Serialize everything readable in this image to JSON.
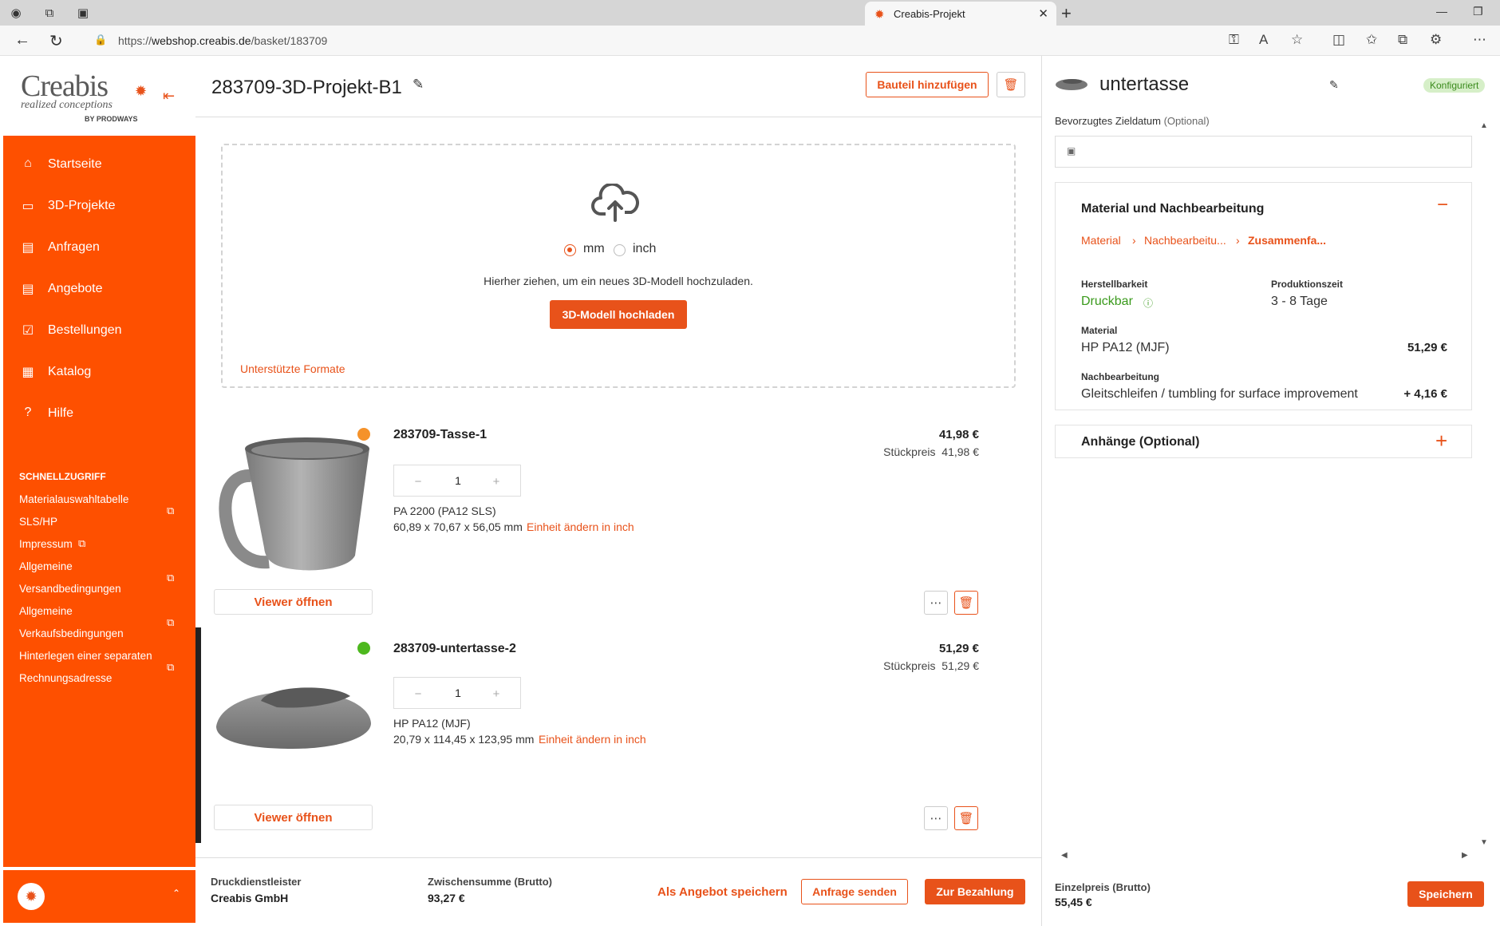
{
  "browser": {
    "tab_title": "Creabis-Projekt",
    "url_prefix": "https://",
    "url_host": "webshop.creabis.de",
    "url_path": "/basket/183709"
  },
  "logo": {
    "word": "Creabis",
    "tagline": "realized conceptions",
    "by": "BY PRODWAYS"
  },
  "sidebar": {
    "items": [
      {
        "label": "Startseite",
        "icon": "home-icon"
      },
      {
        "label": "3D-Projekte",
        "icon": "folder-icon"
      },
      {
        "label": "Anfragen",
        "icon": "inquiry-icon"
      },
      {
        "label": "Angebote",
        "icon": "offer-icon"
      },
      {
        "label": "Bestellungen",
        "icon": "orders-icon"
      },
      {
        "label": "Katalog",
        "icon": "catalog-icon"
      },
      {
        "label": "Hilfe",
        "icon": "help-icon"
      }
    ],
    "quick_heading": "SCHNELLZUGRIFF",
    "quick_links": [
      {
        "line1": "Materialauswahltabelle",
        "line2": "SLS/HP"
      },
      {
        "line1": "Impressum",
        "line2": ""
      },
      {
        "line1": "Allgemeine",
        "line2": "Versandbedingungen"
      },
      {
        "line1": "Allgemeine",
        "line2": "Verkaufsbedingungen"
      },
      {
        "line1": "Hinterlegen einer separaten",
        "line2": "Rechnungsadresse"
      }
    ]
  },
  "project": {
    "title": "283709-3D-Projekt-B1",
    "add_part_label": "Bauteil hinzufügen"
  },
  "upload": {
    "unit_mm": "mm",
    "unit_inch": "inch",
    "selected_unit": "mm",
    "hint": "Hierher ziehen, um ein neues 3D-Modell hochzuladen.",
    "button": "3D-Modell hochladen",
    "formats_link": "Unterstützte Formate"
  },
  "parts": [
    {
      "name": "283709-Tasse-1",
      "status_color": "#f5922a",
      "price": "41,98 €",
      "unit_price_label": "Stückpreis",
      "unit_price": "41,98 €",
      "quantity": "1",
      "material": "PA 2200 (PA12 SLS)",
      "dimensions": "60,89 x 70,67 x 56,05 mm",
      "unit_link": "Einheit ändern in inch",
      "viewer": "Viewer öffnen",
      "selected": false
    },
    {
      "name": "283709-untertasse-2",
      "status_color": "#4db81e",
      "price": "51,29 €",
      "unit_price_label": "Stückpreis",
      "unit_price": "51,29 €",
      "quantity": "1",
      "material": "HP PA12 (MJF)",
      "dimensions": "20,79 x 114,45 x 123,95 mm",
      "unit_link": "Einheit ändern in inch",
      "viewer": "Viewer öffnen",
      "selected": true
    }
  ],
  "footer": {
    "provider_label": "Druckdienstleister",
    "provider": "Creabis GmbH",
    "subtotal_label": "Zwischensumme (Brutto)",
    "subtotal": "93,27 €",
    "save_offer": "Als Angebot speichern",
    "send_inquiry": "Anfrage senden",
    "checkout": "Zur Bezahlung"
  },
  "detail": {
    "title": "untertasse",
    "badge": "Konfiguriert",
    "target_date_label": "Bevorzugtes Zieldatum",
    "target_date_optional": "(Optional)",
    "material_section": "Material und Nachbearbeitung",
    "crumbs": [
      "Material",
      "Nachbearbeitu...",
      "Zusammenfa..."
    ],
    "manufacturability_label": "Herstellbarkeit",
    "manufacturability": "Druckbar",
    "production_time_label": "Produktionszeit",
    "production_time": "3 - 8 Tage",
    "material_label": "Material",
    "material": "HP PA12 (MJF)",
    "material_price": "51,29 €",
    "post_label": "Nachbearbeitung",
    "post": "Gleitschleifen / tumbling for surface improvement",
    "post_price": "+ 4,16 €",
    "attachments": "Anhänge (Optional)",
    "unit_price_label": "Einzelpreis (Brutto)",
    "unit_price": "55,45 €",
    "save": "Speichern"
  },
  "colors": {
    "accent": "#fe5000",
    "link": "#e8521a",
    "ok": "#3a9a1c"
  }
}
